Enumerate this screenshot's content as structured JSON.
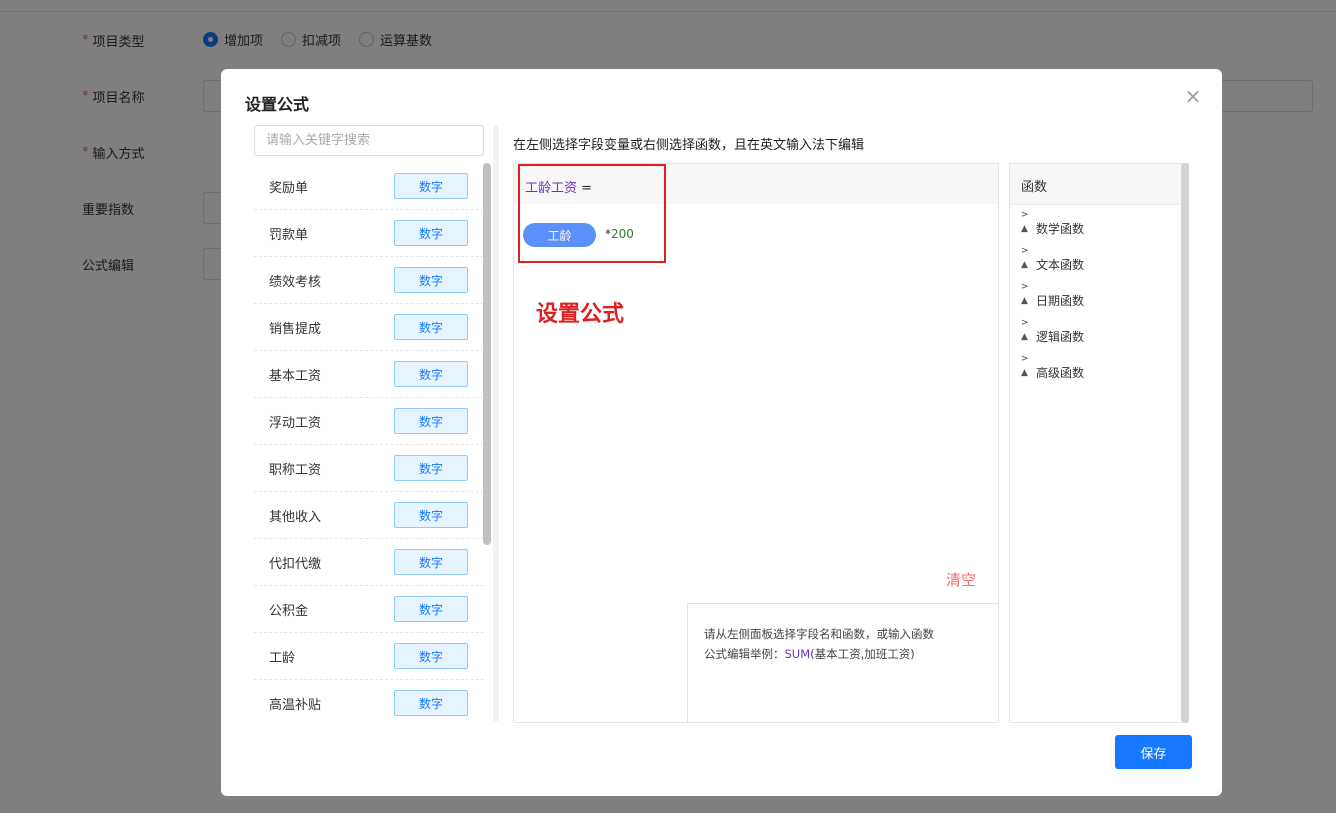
{
  "form": {
    "type_label": "项目类型",
    "name_label": "项目名称",
    "input_label": "输入方式",
    "weight_label": "重要指数",
    "formula_label": "公式编辑",
    "type_options": [
      {
        "label": "增加项",
        "checked": true
      },
      {
        "label": "扣减项",
        "checked": false
      },
      {
        "label": "运算基数",
        "checked": false
      }
    ]
  },
  "modal": {
    "title": "设置公式",
    "close_icon": "×",
    "search_placeholder": "请输入关键字搜索",
    "hint": "在左侧选择字段变量或右侧选择函数，且在英文输入法下编辑",
    "fields": [
      {
        "name": "奖励单",
        "tag": "数字"
      },
      {
        "name": "罚款单",
        "tag": "数字"
      },
      {
        "name": "绩效考核",
        "tag": "数字"
      },
      {
        "name": "销售提成",
        "tag": "数字"
      },
      {
        "name": "基本工资",
        "tag": "数字"
      },
      {
        "name": "浮动工资",
        "tag": "数字"
      },
      {
        "name": "职称工资",
        "tag": "数字"
      },
      {
        "name": "其他收入",
        "tag": "数字"
      },
      {
        "name": "代扣代缴",
        "tag": "数字"
      },
      {
        "name": "公积金",
        "tag": "数字"
      },
      {
        "name": "工龄",
        "tag": "数字"
      },
      {
        "name": "高温补贴",
        "tag": "数字"
      }
    ],
    "editor": {
      "formula_name": "工龄工资",
      "equals": " =",
      "chip": "工龄",
      "operator": "*",
      "number": "200",
      "annotation": "设置公式",
      "clear": "清空",
      "help_line1": "请从左侧面板选择字段名和函数，或输入函数",
      "help_prefix": "公式编辑举例：",
      "help_func": "SUM",
      "help_args": "(基本工资,加班工资)"
    },
    "functions": {
      "header": "函数",
      "expand_glyph": ">",
      "tri_glyph": "▲",
      "items": [
        "数学函数",
        "文本函数",
        "日期函数",
        "逻辑函数",
        "高级函数"
      ]
    },
    "save_label": "保存"
  },
  "colors": {
    "primary": "#1677ff",
    "chip": "#5b8ff9",
    "annotation": "#e02020",
    "field_var": "#722ed1",
    "danger": "#f56c6c"
  }
}
